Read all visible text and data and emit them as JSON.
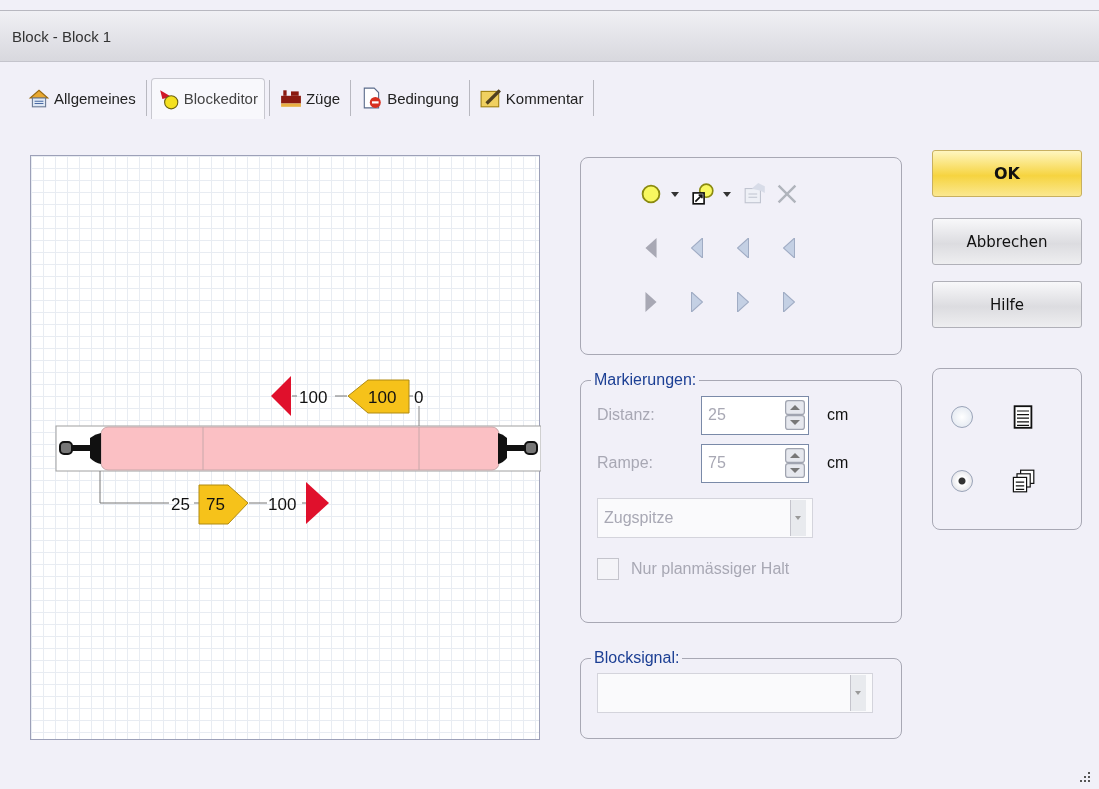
{
  "window": {
    "title": "Block - Block 1"
  },
  "tabs": [
    {
      "label": "Allgemeines",
      "selected": false
    },
    {
      "label": "Blockeditor",
      "selected": true
    },
    {
      "label": "Züge",
      "selected": false
    },
    {
      "label": "Bedingung",
      "selected": false
    },
    {
      "label": "Kommentar",
      "selected": false
    }
  ],
  "diagram": {
    "upper_marks": {
      "arrow_distance": "100",
      "ramp": "100",
      "start": "0"
    },
    "lower_marks": {
      "start": "25",
      "ramp": "75",
      "arrow_distance": "100"
    }
  },
  "markierungen": {
    "title": "Markierungen:",
    "disabled": true,
    "fields": [
      {
        "label": "Distanz:",
        "value": "25",
        "unit": "cm"
      },
      {
        "label": "Rampe:",
        "value": "75",
        "unit": "cm"
      }
    ],
    "dropdown": {
      "value": "Zugspitze"
    },
    "checkbox": {
      "label": "Nur planmässiger Halt",
      "checked": false
    }
  },
  "blocksignal": {
    "title": "Blocksignal:"
  },
  "buttons": [
    {
      "label": "OK",
      "kind": "default"
    },
    {
      "label": "Abbrechen",
      "kind": "normal"
    },
    {
      "label": "Hilfe",
      "kind": "normal"
    }
  ],
  "view_options": [
    {
      "kind": "list",
      "selected": false
    },
    {
      "kind": "cards",
      "selected": true
    }
  ]
}
